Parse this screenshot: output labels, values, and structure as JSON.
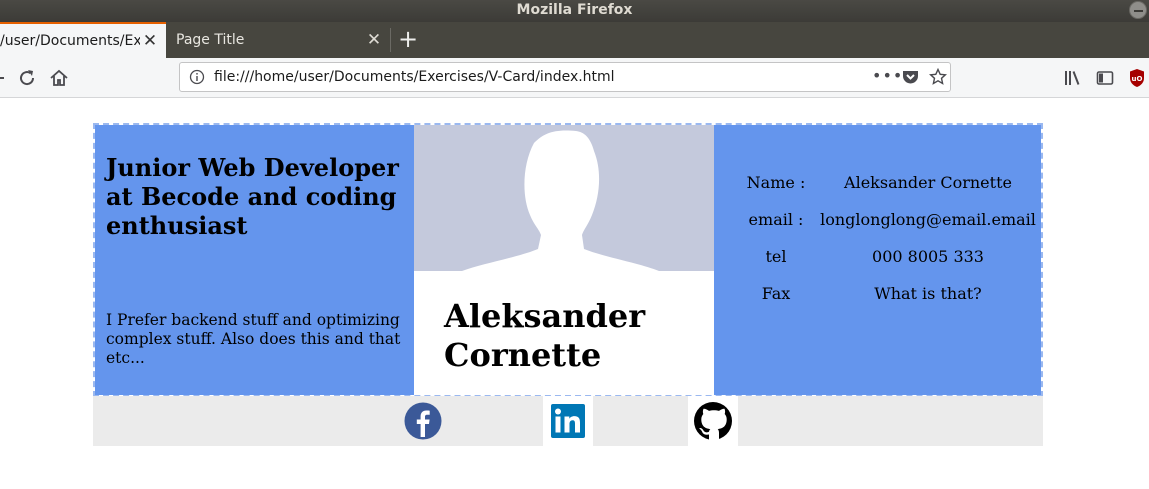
{
  "window": {
    "title": "Mozilla Firefox"
  },
  "tabs": [
    {
      "label": "/user/Documents/Exe",
      "active": true
    },
    {
      "label": "Page Title",
      "active": false
    }
  ],
  "toolbar": {
    "url": "file:///home/user/Documents/Exercises/V-Card/index.html",
    "icons": [
      "reload-icon",
      "home-icon",
      "info-icon",
      "page-actions-icon",
      "pocket-icon",
      "bookmark-star-icon",
      "library-icon",
      "sidebar-icon",
      "ublock-icon"
    ]
  },
  "card": {
    "headline": "Junior Web Developer at Becode and coding enthusiast",
    "bio": "I Prefer backend stuff and optimizing complex stuff. Also does this and that etc...",
    "name": "Aleksander Cornette",
    "info": [
      {
        "label": "Name :",
        "value": "Aleksander Cornette"
      },
      {
        "label": "email :",
        "value": "longlonglong@email.email"
      },
      {
        "label": "tel",
        "value": "000 8005 333"
      },
      {
        "label": "Fax",
        "value": "What is that?"
      }
    ]
  },
  "social": [
    "facebook-icon",
    "linkedin-icon",
    "github-icon"
  ],
  "colors": {
    "panel_blue": "#6495ed",
    "photo_bg": "#c4c9dc",
    "social_bar": "#ebebeb",
    "tab_accent": "#e66000"
  }
}
